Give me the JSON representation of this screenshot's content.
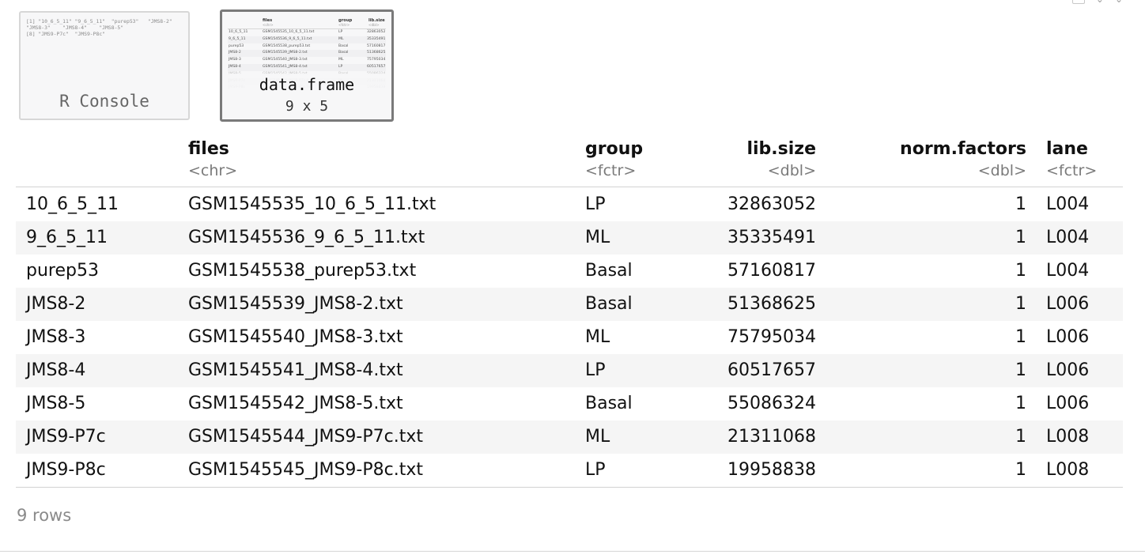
{
  "console_thumb": {
    "preview": "[1] \"10_6_5_11\" \"9_6_5_11\"  \"purep53\"   \"JMS8-2\"\n\"JMS8-3\"    \"JMS8-4\"    \"JMS8-5\"\n[8] \"JMS9-P7c\"  \"JMS9-P8c\"",
    "label": "R Console"
  },
  "df_thumb": {
    "label": "data.frame",
    "dims": "9 x 5",
    "mini_headers": [
      "files",
      "group",
      "lib.size"
    ],
    "mini_types": [
      "<chr>",
      "<fctr>",
      "<dbl>"
    ],
    "mini_rows": [
      [
        "10_6_5_11",
        "GSM1545535_10_6_5_11.txt",
        "LP",
        "32863052"
      ],
      [
        "9_6_5_11",
        "GSM1545536_9_6_5_11.txt",
        "ML",
        "35335491"
      ],
      [
        "purep53",
        "GSM1545538_purep53.txt",
        "Basal",
        "57160817"
      ],
      [
        "JMS8-2",
        "GSM1545539_JMS8-2.txt",
        "Basal",
        "51368625"
      ],
      [
        "JMS8-3",
        "GSM1545540_JMS8-3.txt",
        "ML",
        "75795034"
      ],
      [
        "JMS8-4",
        "GSM1545541_JMS8-4.txt",
        "LP",
        "60517657"
      ],
      [
        "JMS8-5",
        "GSM1545542_JMS8-5.txt",
        "Basal",
        "55086324"
      ],
      [
        "JMS9-P7c",
        "GSM1545544_JMS9-P7c.txt",
        "ML",
        "21311068"
      ],
      [
        "JMS9-P8c",
        "GSM1545545_JMS9-P8c.txt",
        "LP",
        "19958838"
      ]
    ]
  },
  "table": {
    "columns": [
      {
        "name": "files",
        "type": "<chr>"
      },
      {
        "name": "group",
        "type": "<fctr>"
      },
      {
        "name": "lib.size",
        "type": "<dbl>"
      },
      {
        "name": "norm.factors",
        "type": "<dbl>"
      },
      {
        "name": "lane",
        "type": "<fctr>"
      }
    ],
    "rows": [
      {
        "rowname": "10_6_5_11",
        "files": "GSM1545535_10_6_5_11.txt",
        "group": "LP",
        "lib_size": "32863052",
        "norm_factors": "1",
        "lane": "L004"
      },
      {
        "rowname": "9_6_5_11",
        "files": "GSM1545536_9_6_5_11.txt",
        "group": "ML",
        "lib_size": "35335491",
        "norm_factors": "1",
        "lane": "L004"
      },
      {
        "rowname": "purep53",
        "files": "GSM1545538_purep53.txt",
        "group": "Basal",
        "lib_size": "57160817",
        "norm_factors": "1",
        "lane": "L004"
      },
      {
        "rowname": "JMS8-2",
        "files": "GSM1545539_JMS8-2.txt",
        "group": "Basal",
        "lib_size": "51368625",
        "norm_factors": "1",
        "lane": "L006"
      },
      {
        "rowname": "JMS8-3",
        "files": "GSM1545540_JMS8-3.txt",
        "group": "ML",
        "lib_size": "75795034",
        "norm_factors": "1",
        "lane": "L006"
      },
      {
        "rowname": "JMS8-4",
        "files": "GSM1545541_JMS8-4.txt",
        "group": "LP",
        "lib_size": "60517657",
        "norm_factors": "1",
        "lane": "L006"
      },
      {
        "rowname": "JMS8-5",
        "files": "GSM1545542_JMS8-5.txt",
        "group": "Basal",
        "lib_size": "55086324",
        "norm_factors": "1",
        "lane": "L006"
      },
      {
        "rowname": "JMS9-P7c",
        "files": "GSM1545544_JMS9-P7c.txt",
        "group": "ML",
        "lib_size": "21311068",
        "norm_factors": "1",
        "lane": "L008"
      },
      {
        "rowname": "JMS9-P8c",
        "files": "GSM1545545_JMS9-P8c.txt",
        "group": "LP",
        "lib_size": "19958838",
        "norm_factors": "1",
        "lane": "L008"
      }
    ]
  },
  "footer": {
    "row_count": "9 rows"
  },
  "toolbar_icons": [
    "window-icon",
    "expand-icon",
    "close-icon"
  ]
}
